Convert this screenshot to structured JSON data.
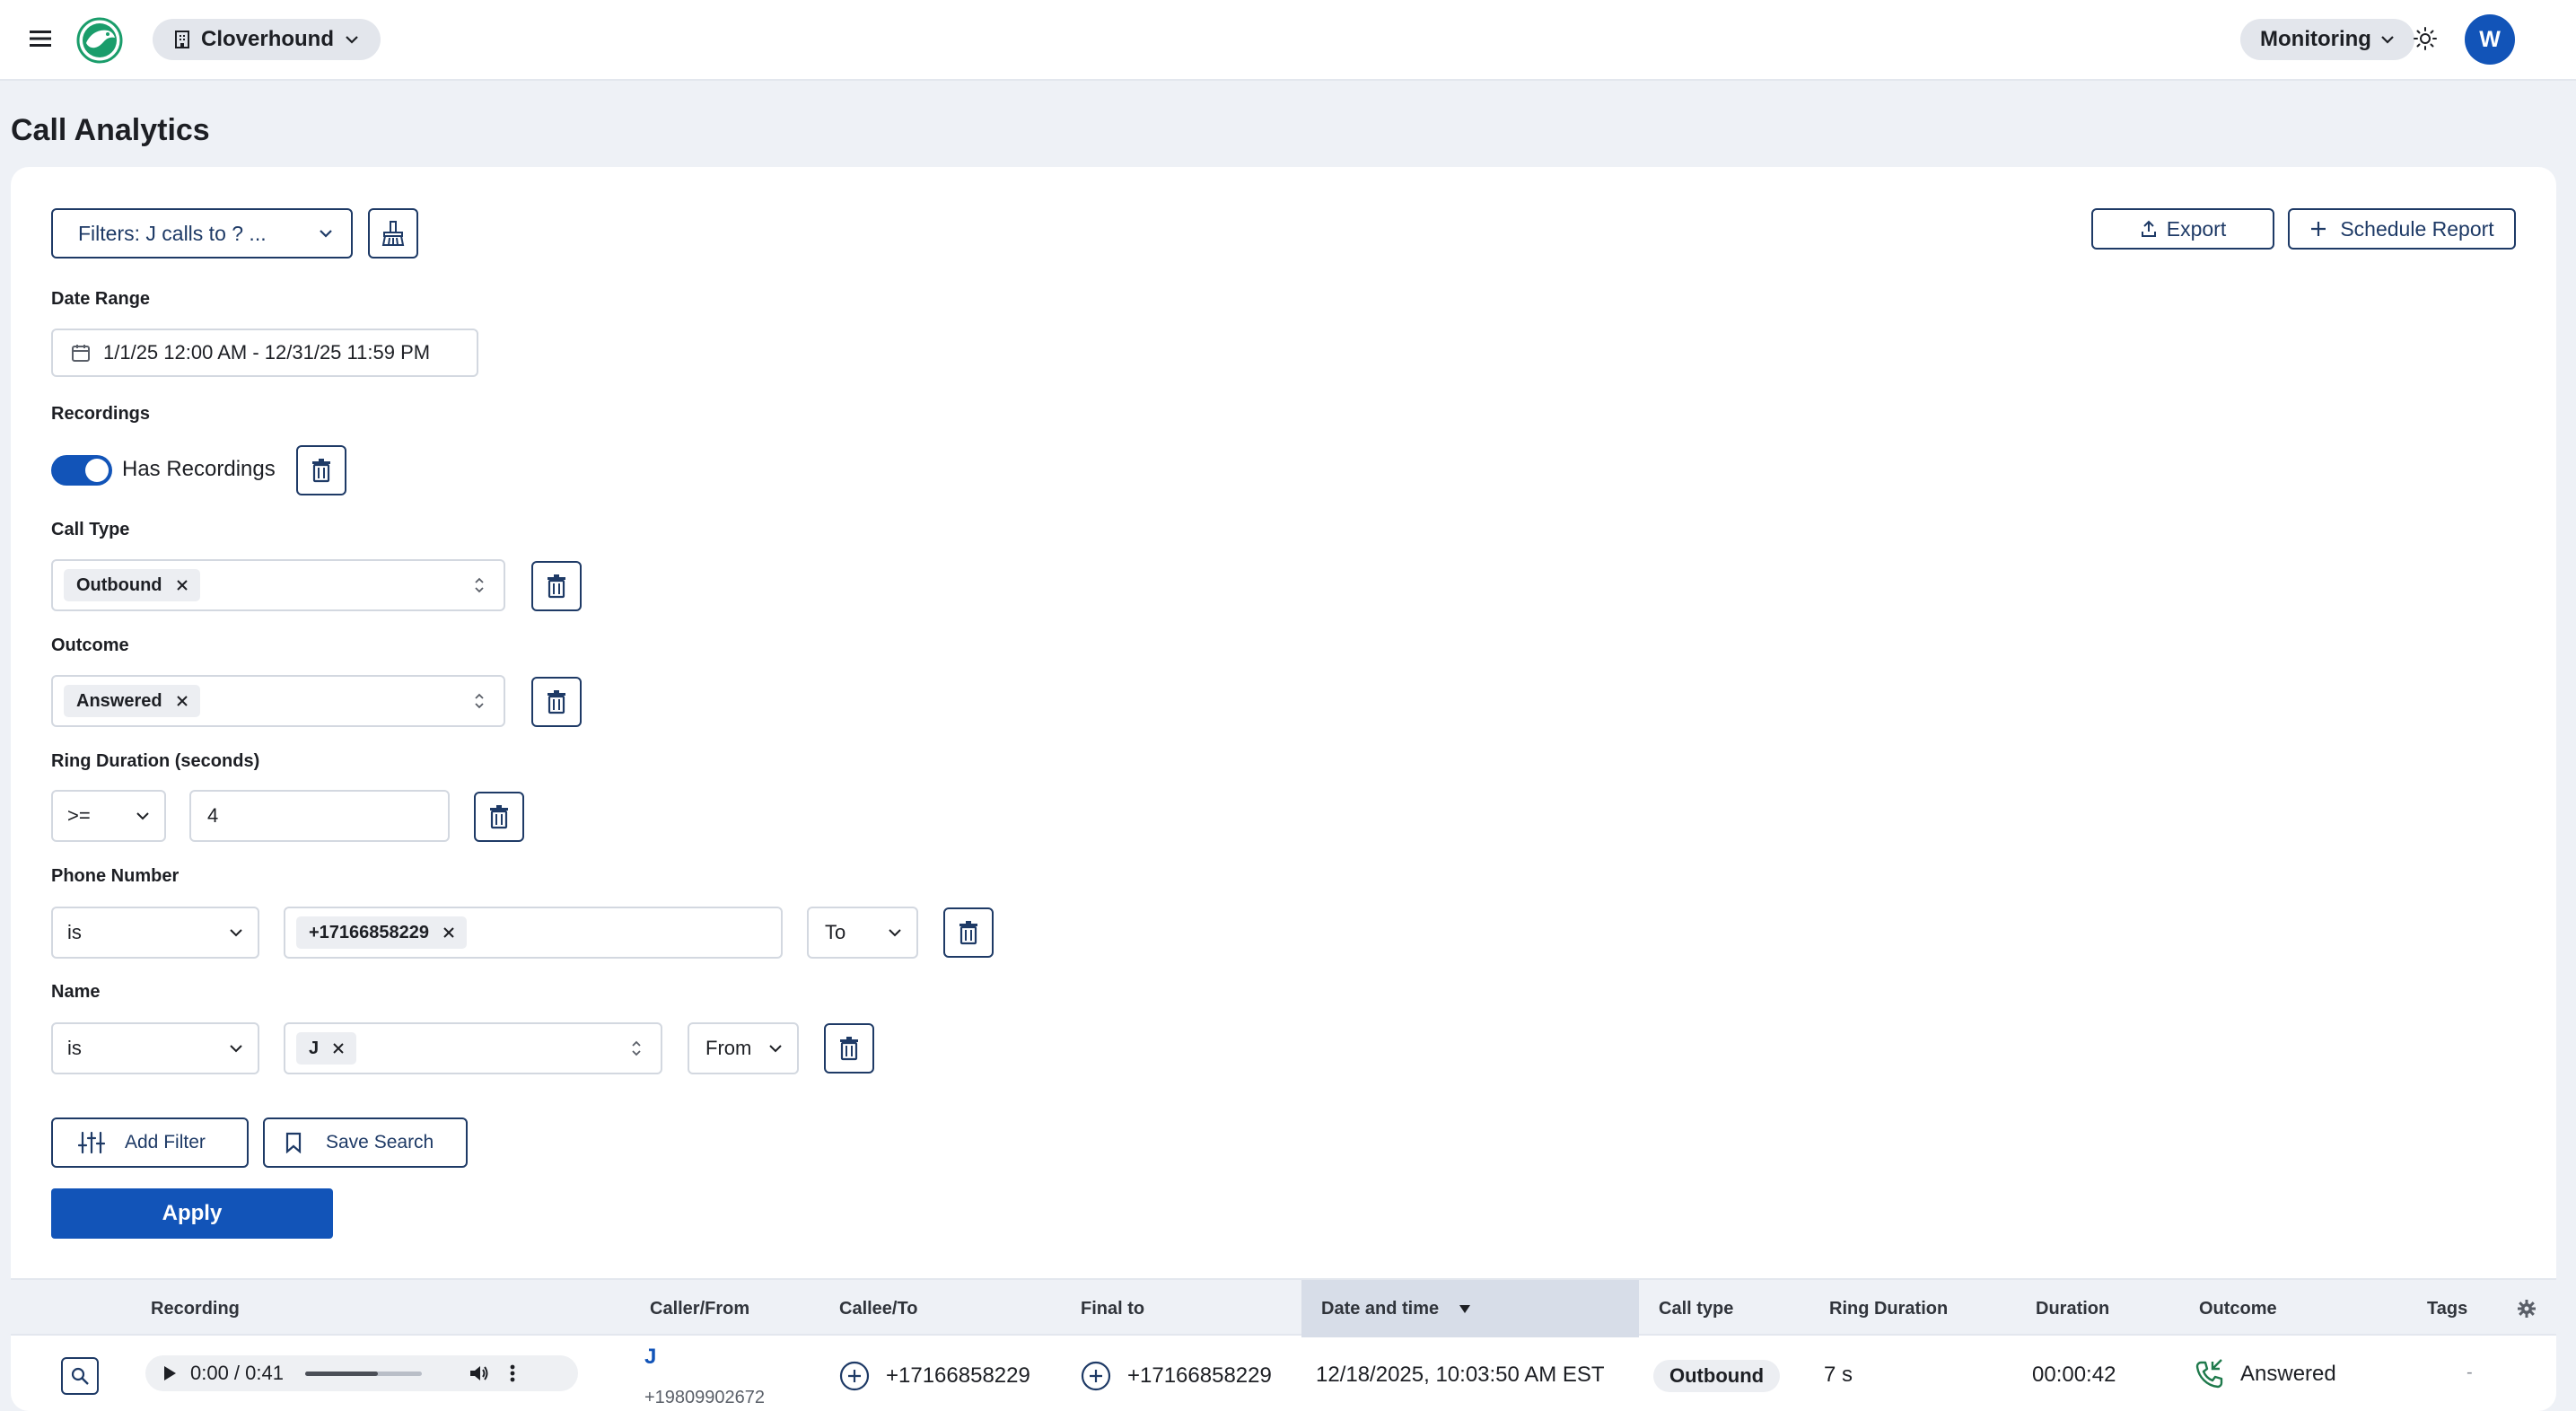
{
  "header": {
    "org_name": "Cloverhound",
    "monitoring_label": "Monitoring",
    "avatar_initial": "W"
  },
  "page": {
    "title": "Call Analytics"
  },
  "toolbar": {
    "filters_label": "Filters: J calls to ? ...",
    "export_label": "Export",
    "schedule_label": "Schedule Report"
  },
  "filters": {
    "date_range": {
      "label": "Date Range",
      "value": "1/1/25 12:00 AM - 12/31/25 11:59 PM"
    },
    "recordings": {
      "label": "Recordings",
      "toggle_label": "Has Recordings",
      "on": true
    },
    "call_type": {
      "label": "Call Type",
      "chip": "Outbound"
    },
    "outcome": {
      "label": "Outcome",
      "chip": "Answered"
    },
    "ring_duration": {
      "label": "Ring Duration (seconds)",
      "operator": ">=",
      "value": "4"
    },
    "phone_number": {
      "label": "Phone Number",
      "operator": "is",
      "chip": "+17166858229",
      "direction": "To"
    },
    "name": {
      "label": "Name",
      "operator": "is",
      "chip": "J",
      "direction": "From"
    },
    "add_filter_label": "Add Filter",
    "save_search_label": "Save Search",
    "apply_label": "Apply"
  },
  "table": {
    "columns": [
      "Recording",
      "Caller/From",
      "Callee/To",
      "Final to",
      "Date and time",
      "Call type",
      "Ring Duration",
      "Duration",
      "Outcome",
      "Tags"
    ],
    "sorted_column": "Date and time",
    "sort_direction": "desc",
    "rows": [
      {
        "player_time": "0:00 / 0:41",
        "playback_progress": 0.62,
        "caller_name": "J",
        "caller_number": "+19809902672",
        "callee": "+17166858229",
        "final_to": "+17166858229",
        "datetime": "12/18/2025, 10:03:50 AM EST",
        "call_type": "Outbound",
        "ring_duration": "7 s",
        "duration": "00:00:42",
        "outcome": "Answered",
        "tags": "-"
      }
    ]
  },
  "colors": {
    "primary": "#1254b8",
    "outline": "#1e3a66",
    "logo": "#1a9d6b",
    "answered_icon": "#1f7a4c"
  }
}
